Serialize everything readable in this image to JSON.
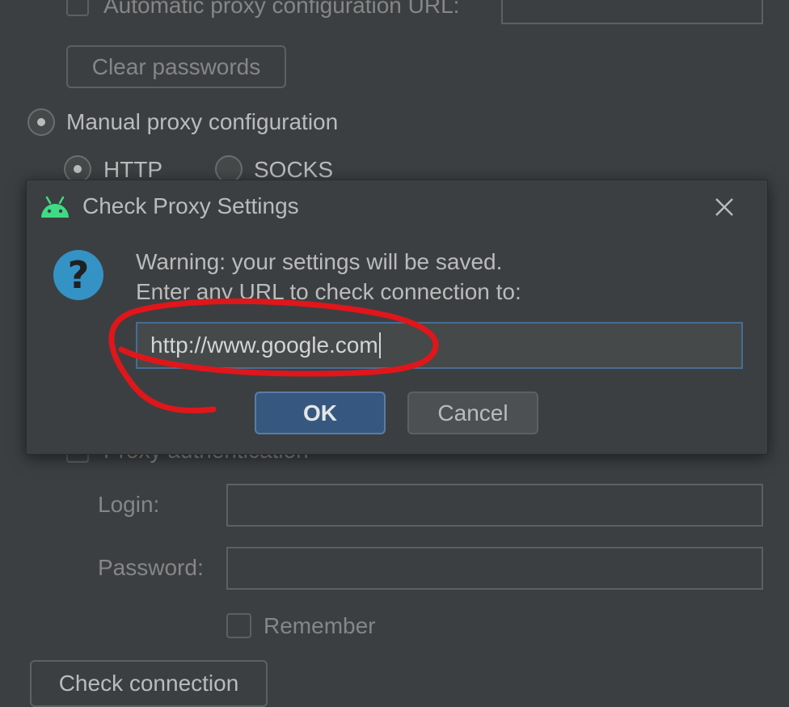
{
  "settings": {
    "auto_proxy_url_label": "Automatic proxy configuration URL:",
    "clear_passwords_label": "Clear passwords",
    "manual_proxy_label": "Manual proxy configuration",
    "http_label": "HTTP",
    "socks_label": "SOCKS",
    "proxy_auth_label": "Proxy authentication",
    "login_label": "Login:",
    "password_label": "Password:",
    "remember_label": "Remember",
    "check_connection_label": "Check connection"
  },
  "dialog": {
    "title": "Check Proxy Settings",
    "warning_line1": "Warning: your settings will be saved.",
    "warning_line2": "Enter any URL to check connection to:",
    "url_value": "http://www.google.com",
    "ok_label": "OK",
    "cancel_label": "Cancel",
    "icons": {
      "app": "android-icon",
      "question": "question-icon",
      "close": "close-icon"
    }
  },
  "colors": {
    "background": "#3c3f41",
    "android_green": "#3ddc84",
    "question_blue": "#3592c4",
    "ok_button": "#365880",
    "annotation_red": "#e0161b"
  }
}
